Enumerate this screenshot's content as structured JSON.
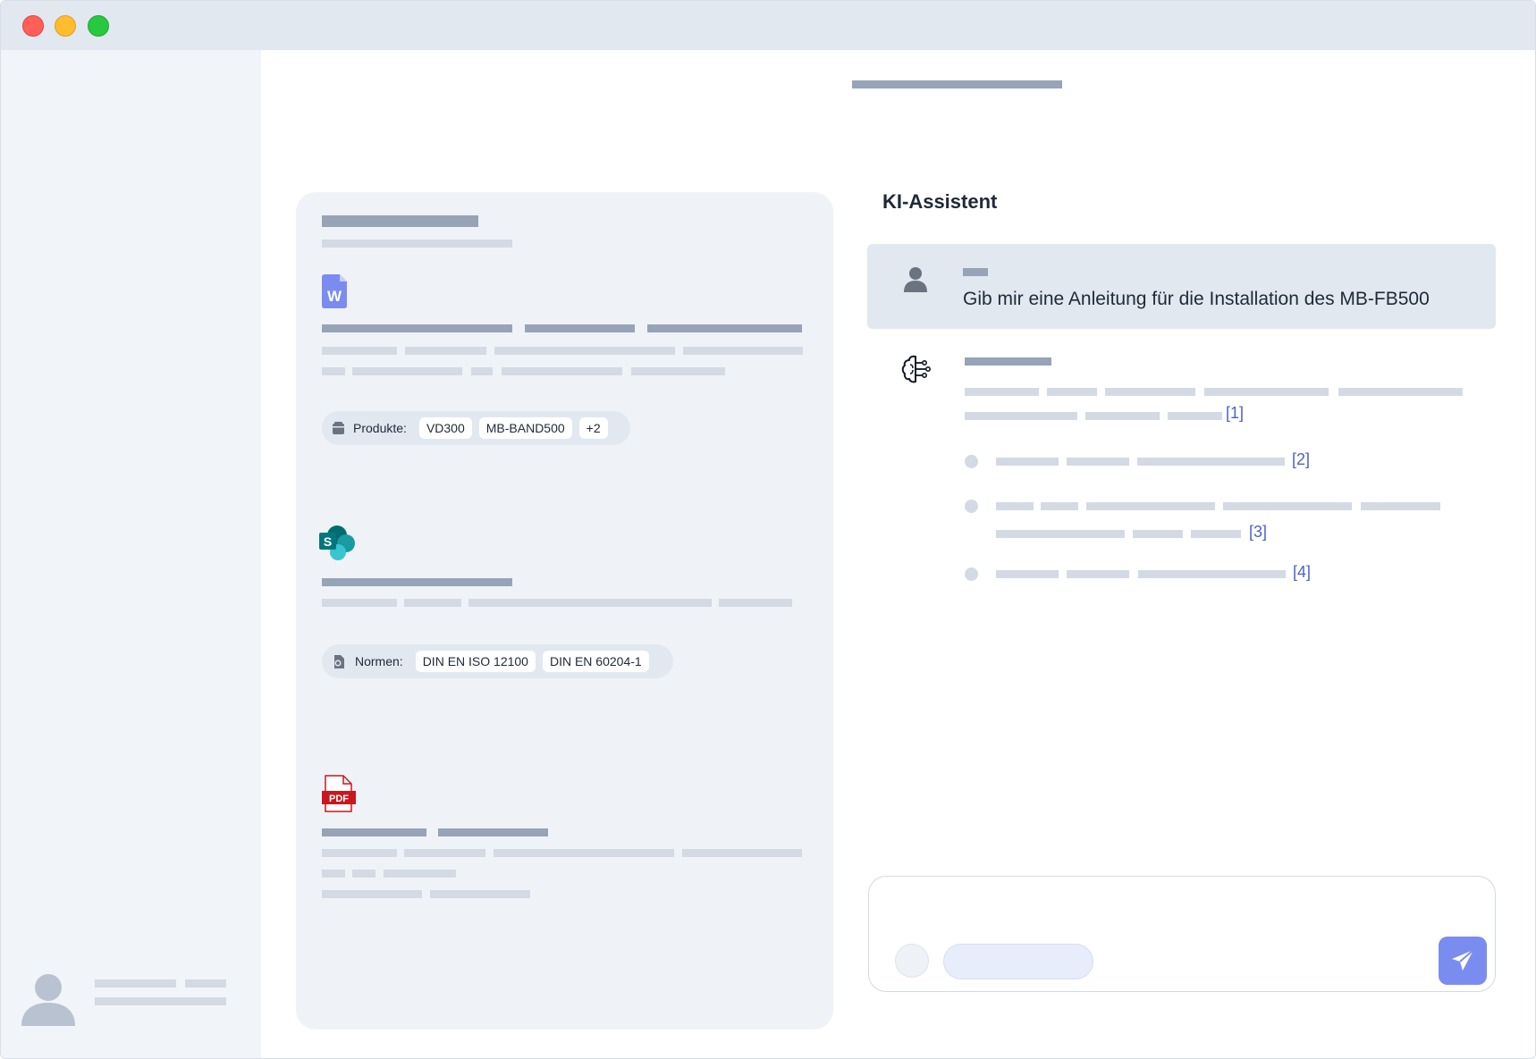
{
  "doc_panel": {
    "documents": [
      {
        "type": "word",
        "icon": "word-document-icon",
        "tag_label": "Produkte:",
        "tags": [
          "VD300",
          "MB-BAND500",
          "+2"
        ]
      },
      {
        "type": "sharepoint",
        "icon": "sharepoint-icon",
        "tag_label": "Normen:",
        "tags": [
          "DIN EN ISO 12100",
          "DIN EN 60204-1"
        ]
      },
      {
        "type": "pdf",
        "icon": "pdf-icon",
        "icon_text": "PDF"
      }
    ]
  },
  "assistant": {
    "title": "KI-Assistent",
    "user_message": "Gib mir eine Anleitung für die Installation des MB-FB500",
    "references": [
      "[1]",
      "[2]",
      "[3]",
      "[4]"
    ]
  },
  "colors": {
    "accent": "#7b8cf0",
    "reference_link": "#4f63c8",
    "skeleton_dark": "#97a3b6",
    "skeleton_light": "#d3dae3"
  }
}
